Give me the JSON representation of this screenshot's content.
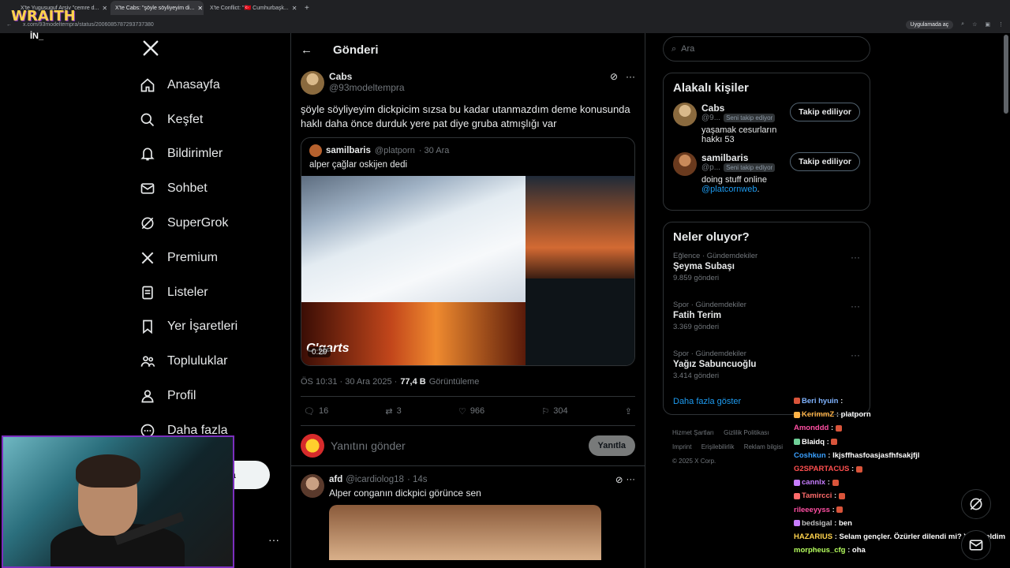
{
  "browser": {
    "tabs": [
      {
        "label": "X'te Yugusuguf Arşiv \"cemre d...",
        "active": false
      },
      {
        "label": "X'te Cabs: \"şöyle söyliyeyim di...",
        "active": true
      },
      {
        "label": "X'te Conflict: \"🇹🇷 Cumhurbaşk...",
        "active": false
      }
    ],
    "url": "x.com/93modeltempra/status/2006085787293737380",
    "app_button": "Uygulamada aç"
  },
  "overlay": {
    "wraith": "WRAITH",
    "wraith_sub": "İN_"
  },
  "sidebar": {
    "items": [
      {
        "label": "Anasayfa",
        "icon": "home-icon"
      },
      {
        "label": "Keşfet",
        "icon": "search-icon"
      },
      {
        "label": "Bildirimler",
        "icon": "bell-icon"
      },
      {
        "label": "Sohbet",
        "icon": "mail-icon"
      },
      {
        "label": "SuperGrok",
        "icon": "grok-icon"
      },
      {
        "label": "Premium",
        "icon": "x-icon"
      },
      {
        "label": "Listeler",
        "icon": "list-icon"
      },
      {
        "label": "Yer İşaretleri",
        "icon": "bookmark-icon"
      },
      {
        "label": "Topluluklar",
        "icon": "people-icon"
      },
      {
        "label": "Profil",
        "icon": "person-icon"
      },
      {
        "label": "Daha fazla",
        "icon": "more-circle-icon"
      }
    ],
    "post_partial": "a"
  },
  "main": {
    "title": "Gönderi",
    "tweet": {
      "name": "Cabs",
      "handle": "@93modeltempra",
      "text": "şöyle söyliyeyim dickpicim sızsa bu kadar utanmazdım deme konusunda haklı daha önce durduk yere pat diye gruba atmışlığı var",
      "quote": {
        "name": "samilbaris",
        "handle": "@platporn",
        "date": "· 30 Ara",
        "text": "alper çağlar oskijen dedi",
        "video_time": "0:29",
        "video_brand": "C'garts"
      },
      "time": "ÖS 10:31 · 30 Ara 2025 ·",
      "views": "77,4 B",
      "views_label": "Görüntüleme",
      "replies": "16",
      "retweets": "3",
      "likes": "966",
      "bookmarks": "304"
    },
    "reply_placeholder": "Yanıtını gönder",
    "reply_button": "Yanıtla",
    "reply": {
      "name": "afd",
      "handle": "@icardiolog18",
      "age": "· 14s",
      "text": "Alper conganın dickpici görünce sen"
    }
  },
  "right": {
    "search_placeholder": "Ara",
    "people_title": "Alakalı kişiler",
    "people": [
      {
        "name": "Cabs",
        "handle": "@9...",
        "badge": "Seni takip ediyor",
        "button": "Takip ediliyor",
        "bio": "yaşamak cesurların hakkı 53",
        "link": ""
      },
      {
        "name": "samilbaris",
        "handle": "@p...",
        "badge": "Seni takip ediyor",
        "button": "Takip ediliyor",
        "bio": "doing stuff online ",
        "link": "@platcornweb",
        "bio_end": "."
      }
    ],
    "trends_title": "Neler oluyor?",
    "trends": [
      {
        "category": "Eğlence · Gündemdekiler",
        "name": "Şeyma Subaşı",
        "count": "9.859 gönderi"
      },
      {
        "category": "Spor · Gündemdekiler",
        "name": "Fatih Terim",
        "count": "3.369 gönderi"
      },
      {
        "category": "Spor · Gündemdekiler",
        "name": "Yağız Sabuncuoğlu",
        "count": "3.414 gönderi"
      }
    ],
    "show_more": "Daha fazla göster",
    "footer": [
      "Hizmet Şartları",
      "Gizlilik Politikası",
      "Imprint",
      "Erişilebilirlik",
      "Reklam bilgisi",
      "© 2025 X Corp."
    ]
  },
  "chat": [
    {
      "user": "Beri hyuin",
      "color": "#7fb3ff",
      "msg": ""
    },
    {
      "user": "KerimmZ",
      "color": "#ffb347",
      "msg": "platporn"
    },
    {
      "user": "Amonddd",
      "color": "#ff4fa3",
      "msg": ""
    },
    {
      "user": "Blaidq",
      "color": "#ffffff",
      "msg": ""
    },
    {
      "user": "Coshkun",
      "color": "#3aa0ff",
      "msg": "lkjsffhasfoasjasfhfsakjfjl"
    },
    {
      "user": "G2SPARTACUS",
      "color": "#ff4f4f",
      "msg": ""
    },
    {
      "user": "cannlx",
      "color": "#c77dff",
      "msg": ""
    },
    {
      "user": "Tamircci",
      "color": "#ff6b6b",
      "msg": ""
    },
    {
      "user": "rileeeyyss",
      "color": "#ff4fa3",
      "msg": ""
    },
    {
      "user": "bedsigal",
      "color": "#c0c0c0",
      "msg": "ben"
    },
    {
      "user": "HAZARIUS",
      "color": "#ffd34d",
      "msg": "Selam gençler. Özürler dilendi mi? Yeni geldim"
    },
    {
      "user": "morpheus_cfg",
      "color": "#b6ff5e",
      "msg": "oha"
    }
  ],
  "colors": {
    "accent": "#1d9bf0",
    "border": "#2f3336",
    "muted": "#71767b"
  }
}
